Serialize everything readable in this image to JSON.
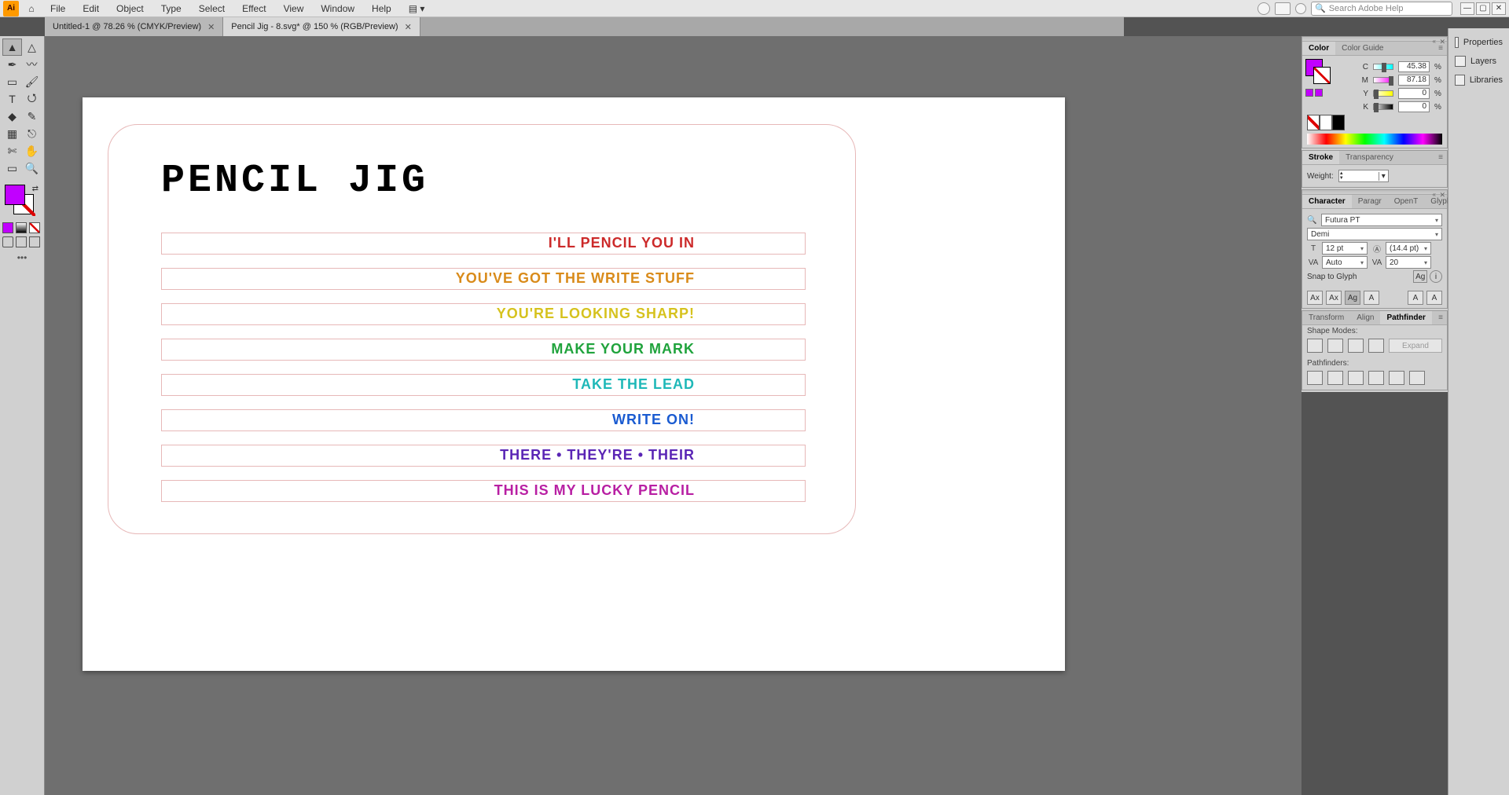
{
  "menubar": {
    "app": "Ai",
    "items": [
      "File",
      "Edit",
      "Object",
      "Type",
      "Select",
      "Effect",
      "View",
      "Window",
      "Help"
    ],
    "search_placeholder": "Search Adobe Help"
  },
  "tabs": [
    {
      "label": "Untitled-1 @ 78.26 % (CMYK/Preview)",
      "active": false
    },
    {
      "label": "Pencil Jig - 8.svg* @ 150 % (RGB/Preview)",
      "active": true
    }
  ],
  "rightbar": {
    "items": [
      "Properties",
      "Layers",
      "Libraries"
    ]
  },
  "color_panel": {
    "tabs": [
      "Color",
      "Color Guide"
    ],
    "channels": [
      {
        "lbl": "C",
        "val": "45.38",
        "pos": 42
      },
      {
        "lbl": "M",
        "val": "87.18",
        "pos": 78
      },
      {
        "lbl": "Y",
        "val": "0",
        "pos": 0
      },
      {
        "lbl": "K",
        "val": "0",
        "pos": 0
      }
    ]
  },
  "stroke_panel": {
    "tabs": [
      "Stroke",
      "Transparency"
    ],
    "weight_label": "Weight:",
    "weight_value": ""
  },
  "char_panel": {
    "tabs": [
      "Character",
      "Paragr",
      "OpenT",
      "Glyphs"
    ],
    "font": "Futura PT",
    "style": "Demi",
    "size": "12 pt",
    "leading": "(14.4 pt)",
    "kerning": "Auto",
    "tracking": "20",
    "snap": "Snap to Glyph"
  },
  "pf_panel": {
    "tabs": [
      "Transform",
      "Align",
      "Pathfinder"
    ],
    "shape_modes": "Shape Modes:",
    "pathfinders": "Pathfinders:",
    "expand": "Expand"
  },
  "artboard": {
    "title": "PENCIL JIG",
    "lines": [
      "I'LL PENCIL YOU IN",
      "YOU'VE GOT THE WRITE STUFF",
      "YOU'RE LOOKING SHARP!",
      "MAKE YOUR MARK",
      "TAKE THE LEAD",
      "WRITE ON!",
      "THERE  •  THEY'RE  •  THEIR",
      "THIS IS MY LUCKY PENCIL"
    ]
  }
}
